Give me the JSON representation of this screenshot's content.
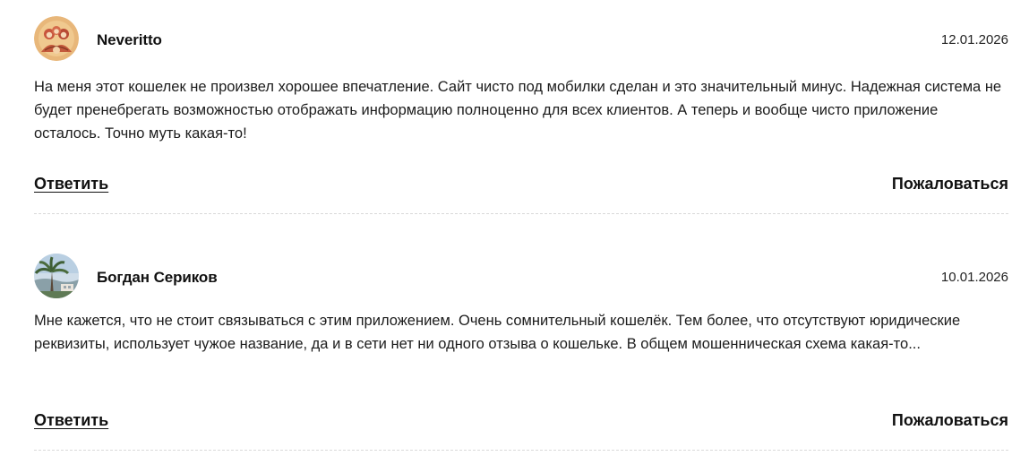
{
  "comments": [
    {
      "author": "Neveritto",
      "date": "12.01.2026",
      "text": "На меня этот кошелек не произвел хорошее впечатление. Сайт чисто под мобилки сделан и это значительный минус. Надежная система не будет пренебрегать возможностью отображать информацию полноценно для всех клиентов. А теперь и вообще чисто приложение осталось. Точно муть какая-то!",
      "reply_label": "Ответить",
      "report_label": "Пожаловаться"
    },
    {
      "author": "Богдан Сериков",
      "date": "10.01.2026",
      "text": "Мне кажется, что не стоит связываться с этим приложением. Очень сомнительный кошелёк. Тем более, что отсутствуют юридические реквизиты, использует чужое название, да и в сети нет ни одного отзыва о кошельке. В общем мошенническая схема какая-то...",
      "reply_label": "Ответить",
      "report_label": "Пожаловаться"
    }
  ]
}
